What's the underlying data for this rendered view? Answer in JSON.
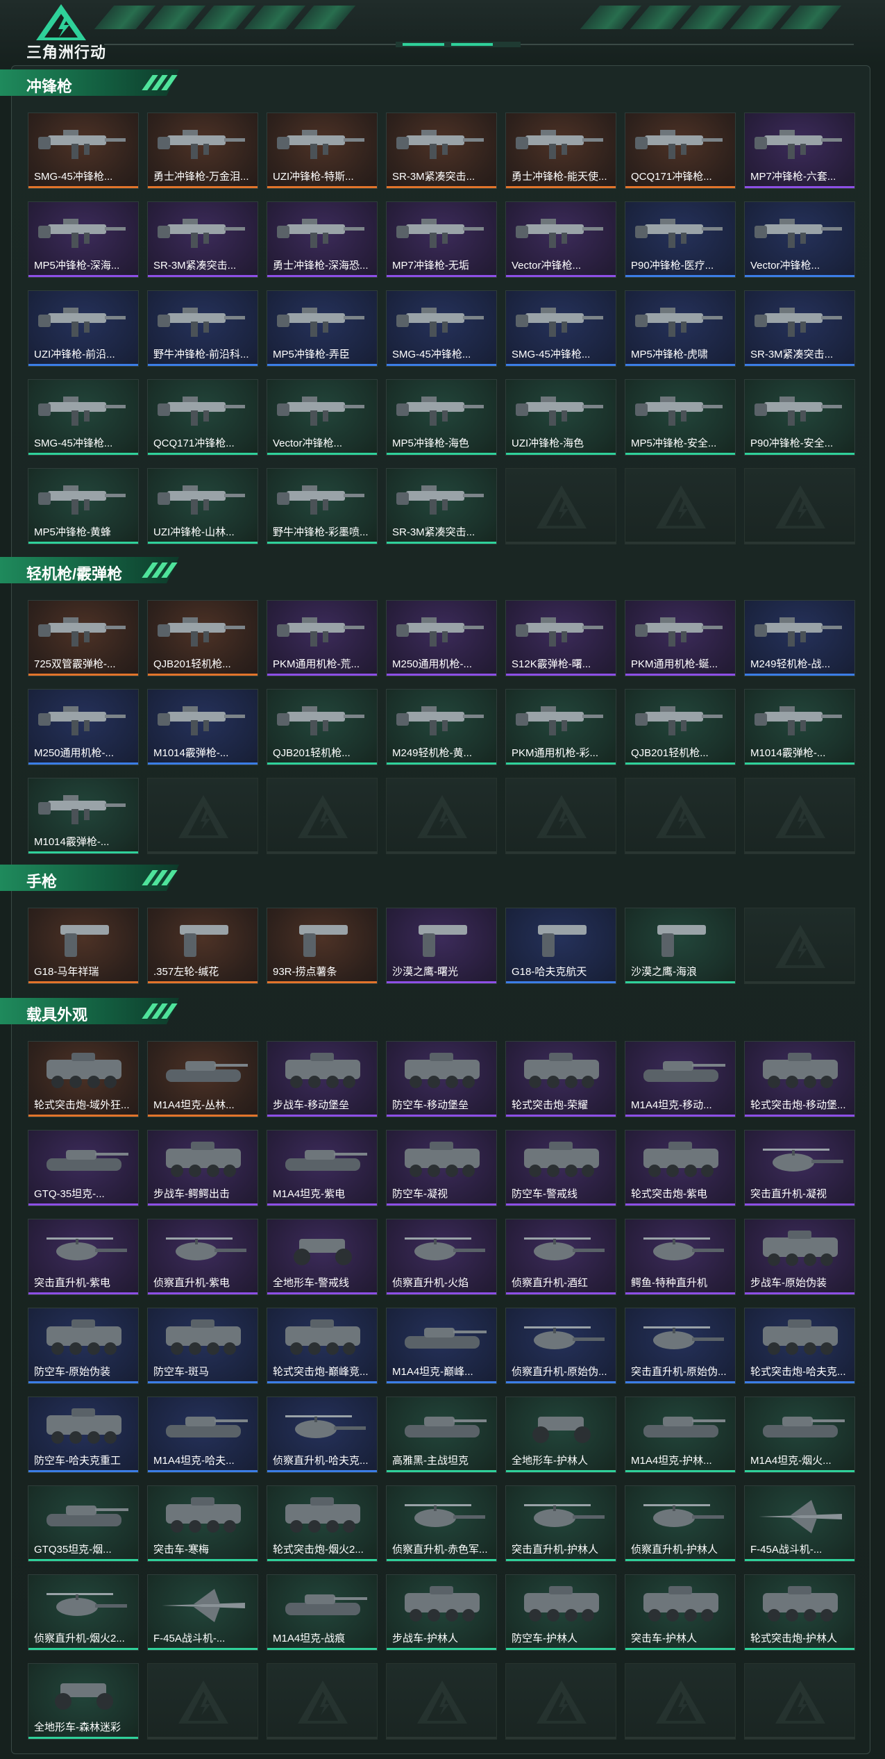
{
  "header": {
    "game_title": "三角洲行动",
    "colors": {
      "accent": "#2fd19a",
      "background": "#16211e"
    }
  },
  "sections": [
    {
      "title": "冲锋枪",
      "items": [
        {
          "name": "SMG-45冲锋枪...",
          "rarity": "orange",
          "icon": "smg-icon"
        },
        {
          "name": "勇士冲锋枪-万金泪...",
          "rarity": "orange",
          "icon": "smg-icon"
        },
        {
          "name": "UZI冲锋枪-特斯...",
          "rarity": "orange",
          "icon": "smg-icon"
        },
        {
          "name": "SR-3M紧凑突击...",
          "rarity": "orange",
          "icon": "smg-icon"
        },
        {
          "name": "勇士冲锋枪-能天使...",
          "rarity": "orange",
          "icon": "smg-icon"
        },
        {
          "name": "QCQ171冲锋枪...",
          "rarity": "orange",
          "icon": "smg-icon"
        },
        {
          "name": "MP7冲锋枪-六套...",
          "rarity": "purple",
          "icon": "smg-icon"
        },
        {
          "name": "MP5冲锋枪-深海...",
          "rarity": "purple",
          "icon": "smg-icon"
        },
        {
          "name": "SR-3M紧凑突击...",
          "rarity": "purple",
          "icon": "smg-icon"
        },
        {
          "name": "勇士冲锋枪-深海恐...",
          "rarity": "purple",
          "icon": "smg-icon"
        },
        {
          "name": "MP7冲锋枪-无垢",
          "rarity": "purple",
          "icon": "smg-icon"
        },
        {
          "name": "Vector冲锋枪...",
          "rarity": "purple",
          "icon": "smg-icon"
        },
        {
          "name": "P90冲锋枪-医疗...",
          "rarity": "blue",
          "icon": "smg-icon"
        },
        {
          "name": "Vector冲锋枪...",
          "rarity": "blue",
          "icon": "smg-icon"
        },
        {
          "name": "UZI冲锋枪-前沿...",
          "rarity": "blue",
          "icon": "smg-icon"
        },
        {
          "name": "野牛冲锋枪-前沿科...",
          "rarity": "blue",
          "icon": "smg-icon"
        },
        {
          "name": "MP5冲锋枪-弄臣",
          "rarity": "blue",
          "icon": "smg-icon"
        },
        {
          "name": "SMG-45冲锋枪...",
          "rarity": "blue",
          "icon": "smg-icon"
        },
        {
          "name": "SMG-45冲锋枪...",
          "rarity": "blue",
          "icon": "smg-icon"
        },
        {
          "name": "MP5冲锋枪-虎啸",
          "rarity": "blue",
          "icon": "smg-icon"
        },
        {
          "name": "SR-3M紧凑突击...",
          "rarity": "blue",
          "icon": "smg-icon"
        },
        {
          "name": "SMG-45冲锋枪...",
          "rarity": "green",
          "icon": "smg-icon"
        },
        {
          "name": "QCQ171冲锋枪...",
          "rarity": "green",
          "icon": "smg-icon"
        },
        {
          "name": "Vector冲锋枪...",
          "rarity": "green",
          "icon": "smg-icon"
        },
        {
          "name": "MP5冲锋枪-海色",
          "rarity": "green",
          "icon": "smg-icon"
        },
        {
          "name": "UZI冲锋枪-海色",
          "rarity": "green",
          "icon": "smg-icon"
        },
        {
          "name": "MP5冲锋枪-安全...",
          "rarity": "green",
          "icon": "smg-icon"
        },
        {
          "name": "P90冲锋枪-安全...",
          "rarity": "green",
          "icon": "smg-icon"
        },
        {
          "name": "MP5冲锋枪-黄蜂",
          "rarity": "green",
          "icon": "smg-icon"
        },
        {
          "name": "UZI冲锋枪-山林...",
          "rarity": "green",
          "icon": "smg-icon"
        },
        {
          "name": "野牛冲锋枪-彩墨喷...",
          "rarity": "green",
          "icon": "smg-icon"
        },
        {
          "name": "SR-3M紧凑突击...",
          "rarity": "green",
          "icon": "smg-icon"
        }
      ],
      "empty_slots": 3
    },
    {
      "title": "轻机枪/霰弹枪",
      "items": [
        {
          "name": "725双管霰弹枪-...",
          "rarity": "orange",
          "icon": "shotgun-icon"
        },
        {
          "name": "QJB201轻机枪...",
          "rarity": "orange",
          "icon": "lmg-icon"
        },
        {
          "name": "PKM通用机枪-荒...",
          "rarity": "purple",
          "icon": "lmg-icon"
        },
        {
          "name": "M250通用机枪-...",
          "rarity": "purple",
          "icon": "lmg-icon"
        },
        {
          "name": "S12K霰弹枪-曙...",
          "rarity": "purple",
          "icon": "shotgun-icon"
        },
        {
          "name": "PKM通用机枪-蜒...",
          "rarity": "purple",
          "icon": "lmg-icon"
        },
        {
          "name": "M249轻机枪-战...",
          "rarity": "blue",
          "icon": "lmg-icon"
        },
        {
          "name": "M250通用机枪-...",
          "rarity": "blue",
          "icon": "lmg-icon"
        },
        {
          "name": "M1014霰弹枪-...",
          "rarity": "blue",
          "icon": "shotgun-icon"
        },
        {
          "name": "QJB201轻机枪...",
          "rarity": "green",
          "icon": "lmg-icon"
        },
        {
          "name": "M249轻机枪-黄...",
          "rarity": "green",
          "icon": "lmg-icon"
        },
        {
          "name": "PKM通用机枪-彩...",
          "rarity": "green",
          "icon": "lmg-icon"
        },
        {
          "name": "QJB201轻机枪...",
          "rarity": "green",
          "icon": "lmg-icon"
        },
        {
          "name": "M1014霰弹枪-...",
          "rarity": "green",
          "icon": "shotgun-icon"
        },
        {
          "name": "M1014霰弹枪-...",
          "rarity": "green",
          "icon": "shotgun-icon"
        }
      ],
      "empty_slots": 6
    },
    {
      "title": "手枪",
      "items": [
        {
          "name": "G18-马年祥瑞",
          "rarity": "orange",
          "icon": "pistol-icon"
        },
        {
          "name": ".357左轮-缄花",
          "rarity": "orange",
          "icon": "pistol-icon"
        },
        {
          "name": "93R-捞点薯条",
          "rarity": "orange",
          "icon": "pistol-icon"
        },
        {
          "name": "沙漠之鹰-曙光",
          "rarity": "purple",
          "icon": "pistol-icon"
        },
        {
          "name": "G18-哈夫克航天",
          "rarity": "blue",
          "icon": "pistol-icon"
        },
        {
          "name": "沙漠之鹰-海浪",
          "rarity": "green",
          "icon": "pistol-icon"
        }
      ],
      "empty_slots": 1
    },
    {
      "title": "载具外观",
      "items": [
        {
          "name": "轮式突击炮-域外狂...",
          "rarity": "orange",
          "icon": "vehicle-icon"
        },
        {
          "name": "M1A4坦克-丛林...",
          "rarity": "orange",
          "icon": "tank-icon"
        },
        {
          "name": "步战车-移动堡垒",
          "rarity": "purple",
          "icon": "vehicle-icon"
        },
        {
          "name": "防空车-移动堡垒",
          "rarity": "purple",
          "icon": "vehicle-icon"
        },
        {
          "name": "轮式突击炮-荣耀",
          "rarity": "purple",
          "icon": "vehicle-icon"
        },
        {
          "name": "M1A4坦克-移动...",
          "rarity": "purple",
          "icon": "tank-icon"
        },
        {
          "name": "轮式突击炮-移动堡...",
          "rarity": "purple",
          "icon": "vehicle-icon"
        },
        {
          "name": "GTQ-35坦克-...",
          "rarity": "purple",
          "icon": "tank-icon"
        },
        {
          "name": "步战车-鳄鳄出击",
          "rarity": "purple",
          "icon": "vehicle-icon"
        },
        {
          "name": "M1A4坦克-紫电",
          "rarity": "purple",
          "icon": "tank-icon"
        },
        {
          "name": "防空车-凝视",
          "rarity": "purple",
          "icon": "vehicle-icon"
        },
        {
          "name": "防空车-警戒线",
          "rarity": "purple",
          "icon": "vehicle-icon"
        },
        {
          "name": "轮式突击炮-紫电",
          "rarity": "purple",
          "icon": "vehicle-icon"
        },
        {
          "name": "突击直升机-凝视",
          "rarity": "purple",
          "icon": "helicopter-icon"
        },
        {
          "name": "突击直升机-紫电",
          "rarity": "purple",
          "icon": "helicopter-icon"
        },
        {
          "name": "侦察直升机-紫电",
          "rarity": "purple",
          "icon": "helicopter-icon"
        },
        {
          "name": "全地形车-警戒线",
          "rarity": "purple",
          "icon": "atv-icon"
        },
        {
          "name": "侦察直升机-火焰",
          "rarity": "purple",
          "icon": "helicopter-icon"
        },
        {
          "name": "侦察直升机-酒红",
          "rarity": "purple",
          "icon": "helicopter-icon"
        },
        {
          "name": "鳄鱼-特种直升机",
          "rarity": "purple",
          "icon": "helicopter-icon"
        },
        {
          "name": "步战车-原始伪装",
          "rarity": "purple",
          "icon": "vehicle-icon"
        },
        {
          "name": "防空车-原始伪装",
          "rarity": "blue",
          "icon": "vehicle-icon"
        },
        {
          "name": "防空车-斑马",
          "rarity": "blue",
          "icon": "vehicle-icon"
        },
        {
          "name": "轮式突击炮-巅峰竞...",
          "rarity": "blue",
          "icon": "vehicle-icon"
        },
        {
          "name": "M1A4坦克-巅峰...",
          "rarity": "blue",
          "icon": "tank-icon"
        },
        {
          "name": "侦察直升机-原始伪...",
          "rarity": "blue",
          "icon": "helicopter-icon"
        },
        {
          "name": "突击直升机-原始伪...",
          "rarity": "blue",
          "icon": "helicopter-icon"
        },
        {
          "name": "轮式突击炮-哈夫克...",
          "rarity": "blue",
          "icon": "vehicle-icon"
        },
        {
          "name": "防空车-哈夫克重工",
          "rarity": "blue",
          "icon": "vehicle-icon"
        },
        {
          "name": "M1A4坦克-哈夫...",
          "rarity": "blue",
          "icon": "tank-icon"
        },
        {
          "name": "侦察直升机-哈夫克...",
          "rarity": "blue",
          "icon": "helicopter-icon"
        },
        {
          "name": "高雅黑-主战坦克",
          "rarity": "green",
          "icon": "tank-icon"
        },
        {
          "name": "全地形车-护林人",
          "rarity": "green",
          "icon": "atv-icon"
        },
        {
          "name": "M1A4坦克-护林...",
          "rarity": "green",
          "icon": "tank-icon"
        },
        {
          "name": "M1A4坦克-烟火...",
          "rarity": "green",
          "icon": "tank-icon"
        },
        {
          "name": "GTQ35坦克-烟...",
          "rarity": "green",
          "icon": "tank-icon"
        },
        {
          "name": "突击车-寒梅",
          "rarity": "green",
          "icon": "vehicle-icon"
        },
        {
          "name": "轮式突击炮-烟火2...",
          "rarity": "green",
          "icon": "vehicle-icon"
        },
        {
          "name": "侦察直升机-赤色军...",
          "rarity": "green",
          "icon": "helicopter-icon"
        },
        {
          "name": "突击直升机-护林人",
          "rarity": "green",
          "icon": "helicopter-icon"
        },
        {
          "name": "侦察直升机-护林人",
          "rarity": "green",
          "icon": "helicopter-icon"
        },
        {
          "name": "F-45A战斗机-...",
          "rarity": "green",
          "icon": "jet-icon"
        },
        {
          "name": "侦察直升机-烟火2...",
          "rarity": "green",
          "icon": "helicopter-icon"
        },
        {
          "name": "F-45A战斗机-...",
          "rarity": "green",
          "icon": "jet-icon"
        },
        {
          "name": "M1A4坦克-战痕",
          "rarity": "green",
          "icon": "tank-icon"
        },
        {
          "name": "步战车-护林人",
          "rarity": "green",
          "icon": "vehicle-icon"
        },
        {
          "name": "防空车-护林人",
          "rarity": "green",
          "icon": "vehicle-icon"
        },
        {
          "name": "突击车-护林人",
          "rarity": "green",
          "icon": "vehicle-icon"
        },
        {
          "name": "轮式突击炮-护林人",
          "rarity": "green",
          "icon": "vehicle-icon"
        },
        {
          "name": "全地形车-森林迷彩",
          "rarity": "green",
          "icon": "atv-icon"
        }
      ],
      "empty_slots": 6
    }
  ]
}
